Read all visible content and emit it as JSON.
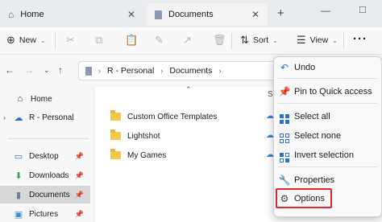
{
  "tabs": [
    {
      "label": "Home"
    },
    {
      "label": "Documents"
    }
  ],
  "window_controls": {
    "new_tab": "+",
    "minimize": "—",
    "maximize": "□"
  },
  "toolbar": {
    "new_label": "New",
    "sort_label": "Sort",
    "view_label": "View",
    "more_label": "···"
  },
  "address": {
    "crumbs": [
      "R - Personal",
      "Documents"
    ]
  },
  "sidebar": {
    "items": [
      {
        "label": "Home",
        "icon": "home-icon"
      },
      {
        "label": "R - Personal",
        "icon": "cloud-icon"
      },
      {
        "label": "Desktop",
        "icon": "desktop-icon"
      },
      {
        "label": "Downloads",
        "icon": "download-icon"
      },
      {
        "label": "Documents",
        "icon": "document-icon"
      },
      {
        "label": "Pictures",
        "icon": "picture-icon"
      }
    ]
  },
  "files": {
    "column_status": "S",
    "rows": [
      {
        "name": "Custom Office Templates"
      },
      {
        "name": "Lightshot"
      },
      {
        "name": "My Games"
      }
    ]
  },
  "menu": {
    "items": [
      {
        "label": "Undo",
        "icon": "undo-icon"
      },
      {
        "label": "Pin to Quick access",
        "icon": "pin-icon"
      },
      {
        "label": "Select all",
        "icon": "select-all-icon"
      },
      {
        "label": "Select none",
        "icon": "select-none-icon"
      },
      {
        "label": "Invert selection",
        "icon": "invert-selection-icon"
      },
      {
        "label": "Properties",
        "icon": "properties-icon"
      },
      {
        "label": "Options",
        "icon": "options-icon"
      }
    ]
  },
  "colors": {
    "accent": "#2a6fd6",
    "highlight": "#e0262d",
    "folder": "#f2c94c"
  }
}
